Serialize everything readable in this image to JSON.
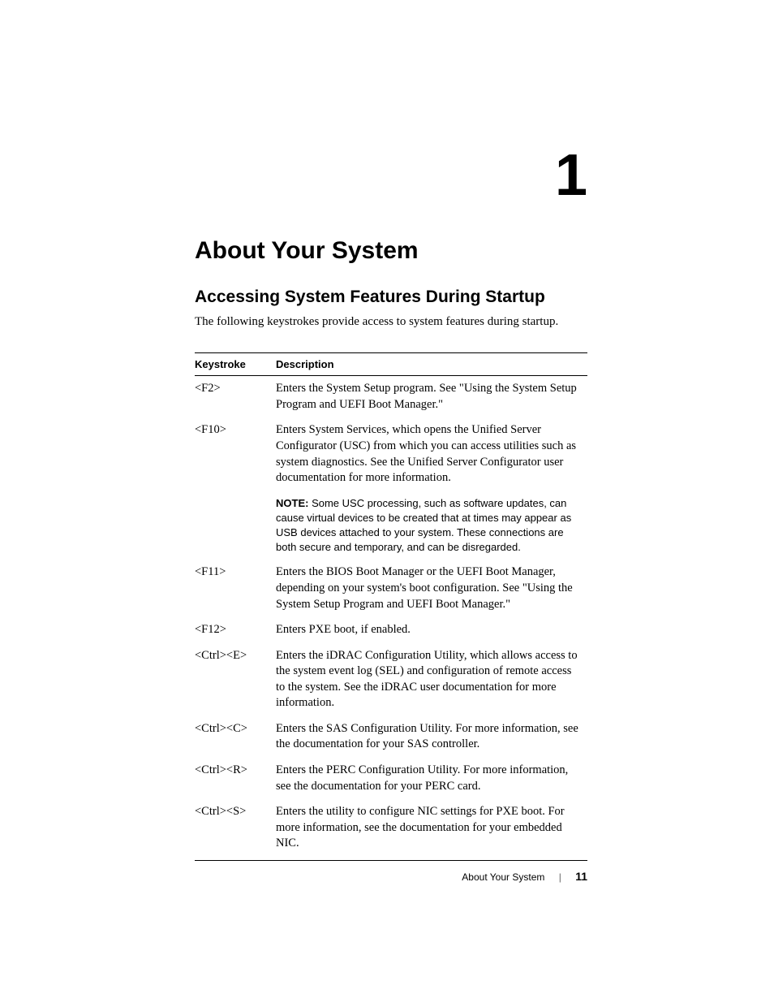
{
  "chapter": {
    "number": "1",
    "title": "About Your System"
  },
  "section": {
    "title": "Accessing System Features During Startup",
    "intro": "The following keystrokes provide access to system features during startup."
  },
  "table": {
    "headers": {
      "keystroke": "Keystroke",
      "description": "Description"
    },
    "rows": [
      {
        "key": "<F2>",
        "desc": "Enters the System Setup program. See \"Using the System Setup Program and UEFI Boot Manager.\""
      },
      {
        "key": "<F10>",
        "desc": "Enters System Services, which opens the Unified Server Configurator (USC) from which you can access utilities such as system diagnostics. See the Unified Server Configurator user documentation for more information."
      },
      {
        "key": "",
        "note_label": "NOTE:",
        "note": " Some USC processing, such as software updates, can cause virtual devices to be created that at times may appear as USB devices attached to your system. These connections are both secure and temporary, and can be disregarded."
      },
      {
        "key": "<F11>",
        "desc": "Enters the BIOS Boot Manager or the UEFI Boot Manager, depending on your system's boot configuration. See \"Using the System Setup Program and UEFI Boot Manager.\""
      },
      {
        "key": "<F12>",
        "desc": "Enters PXE boot, if enabled."
      },
      {
        "key": "<Ctrl><E>",
        "desc": "Enters the iDRAC Configuration Utility, which allows access to the system event log (SEL) and configuration of remote access to the system. See the iDRAC user documentation for more information."
      },
      {
        "key": "<Ctrl><C>",
        "desc": "Enters the SAS Configuration Utility. For more information, see the documentation for your SAS controller."
      },
      {
        "key": "<Ctrl><R>",
        "desc": "Enters the PERC Configuration Utility. For more information, see the documentation for your PERC card."
      },
      {
        "key": "<Ctrl><S>",
        "desc": "Enters the utility to configure NIC settings for PXE boot. For more information, see the documentation for your embedded NIC."
      }
    ]
  },
  "footer": {
    "title": "About Your System",
    "separator": "|",
    "page": "11"
  }
}
